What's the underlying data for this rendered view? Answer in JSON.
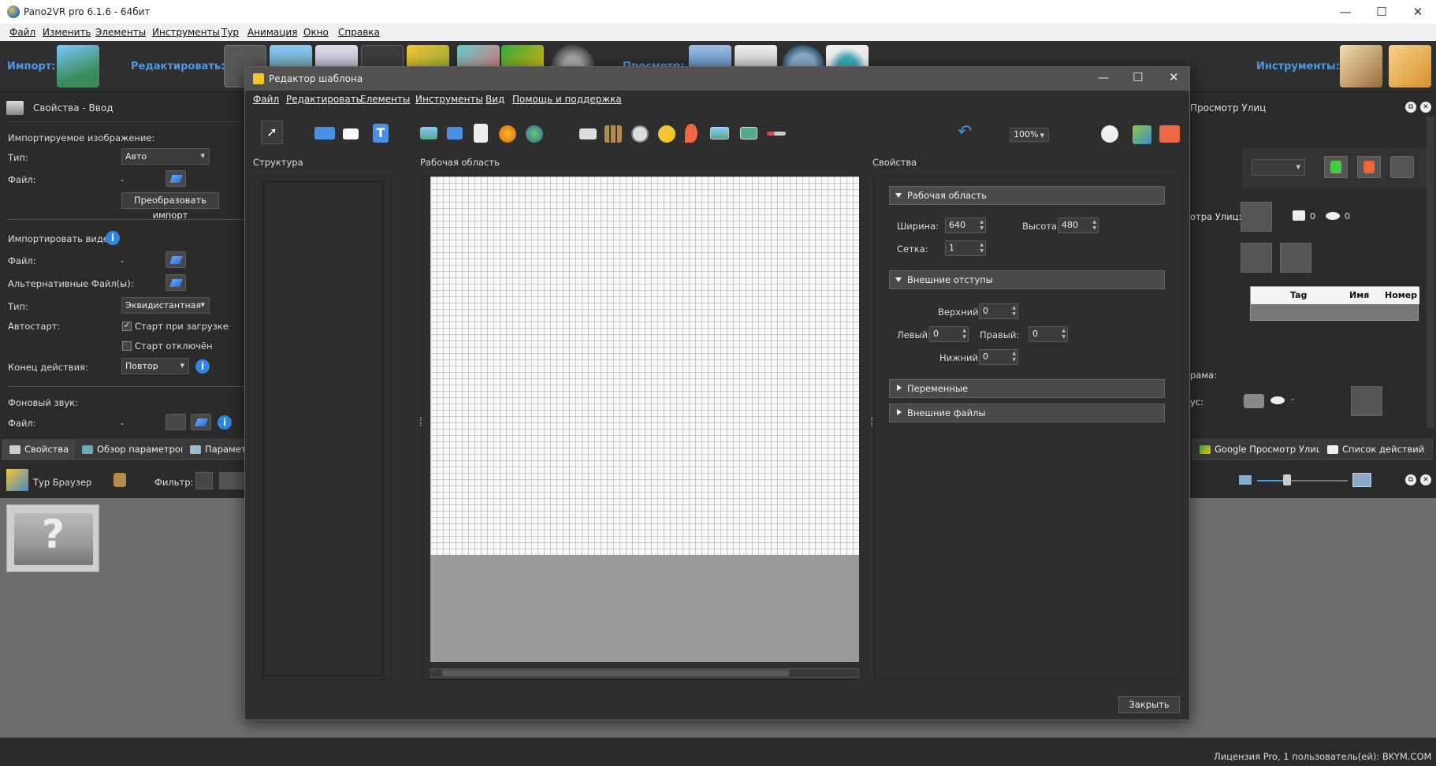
{
  "app": {
    "title": "Pano2VR pro 6.1.6 - 64бит",
    "menu": [
      "Файл",
      "Изменить",
      "Элементы",
      "Инструменты",
      "Тур",
      "Анимация",
      "Окно",
      "Справка"
    ]
  },
  "toolbar": {
    "import_label": "Импорт:",
    "edit_label": "Редактировать:",
    "preview_label": "Просмотр:",
    "tools_label": "Инструменты:"
  },
  "props_panel": {
    "title": "Свойства - Ввод",
    "import_image_section": "Импортируемое изображение:",
    "type_label": "Тип:",
    "type_value": "Авто",
    "file_label": "Файл:",
    "file_value": "-",
    "convert_button": "Преобразовать импорт",
    "import_video_section": "Импортировать видео:",
    "video_file_label": "Файл:",
    "video_file_value": "-",
    "alt_files_label": "Альтернативные Файл(ы):",
    "alt_files_value": "-",
    "video_type_label": "Тип:",
    "video_type_value": "Эквидистантная",
    "autostart_label": "Автостарт:",
    "start_on_load": "Старт при загрузке",
    "start_disabled": "Старт отключён",
    "end_action_label": "Конец действия:",
    "end_action_value": "Повтор",
    "bg_sound_section": "Фоновый звук:",
    "sound_file_label": "Файл:",
    "sound_file_value": "-"
  },
  "bottom_tabs": [
    "Свойства",
    "Обзор параметров",
    "Параметр"
  ],
  "right_tabs": [
    "Google Просмотр Улиц",
    "Список действий"
  ],
  "tour_browser": {
    "title": "Тур Браузер",
    "filter_label": "Фильтр:"
  },
  "right_panel": {
    "title": "Просмотр Улиц",
    "streetview_label": "отра Улиц:",
    "photo_count": "0",
    "view_count": "0",
    "table_headers": [
      "Tag",
      "Имя",
      "Номер"
    ],
    "frame_label": "рама:",
    "status_label": "ус:",
    "status_value": "-"
  },
  "dialog": {
    "title": "Редактор шаблона",
    "menu": [
      "Файл",
      "Редактировать",
      "Елементы",
      "Инструменты",
      "Вид",
      "Помощь и поддержка"
    ],
    "zoom": "100%",
    "structure_label": "Структура",
    "workspace_label": "Рабочая область",
    "properties_label": "Свойства",
    "section_workspace": "Рабочая область",
    "width_label": "Ширина:",
    "width_value": "640",
    "height_label": "Высота:",
    "height_value": "480",
    "grid_label": "Сетка:",
    "grid_value": "1",
    "section_margins": "Внешние отступы",
    "top_label": "Верхний:",
    "top_value": "0",
    "left_label": "Левый:",
    "left_value": "0",
    "right_label": "Правый:",
    "right_value": "0",
    "bottom_label": "Нижний:",
    "bottom_value": "0",
    "section_variables": "Переменные",
    "section_external_files": "Внешние файлы",
    "close_button": "Закрыть"
  },
  "status_bar": {
    "license": "Лицензия Pro, 1 пользователь(ей): BKYM.COM"
  },
  "colors": {
    "accent_blue": "#4a98e8",
    "dark_bg": "#2b2b2b",
    "grid_line": "#c8c8c8"
  }
}
